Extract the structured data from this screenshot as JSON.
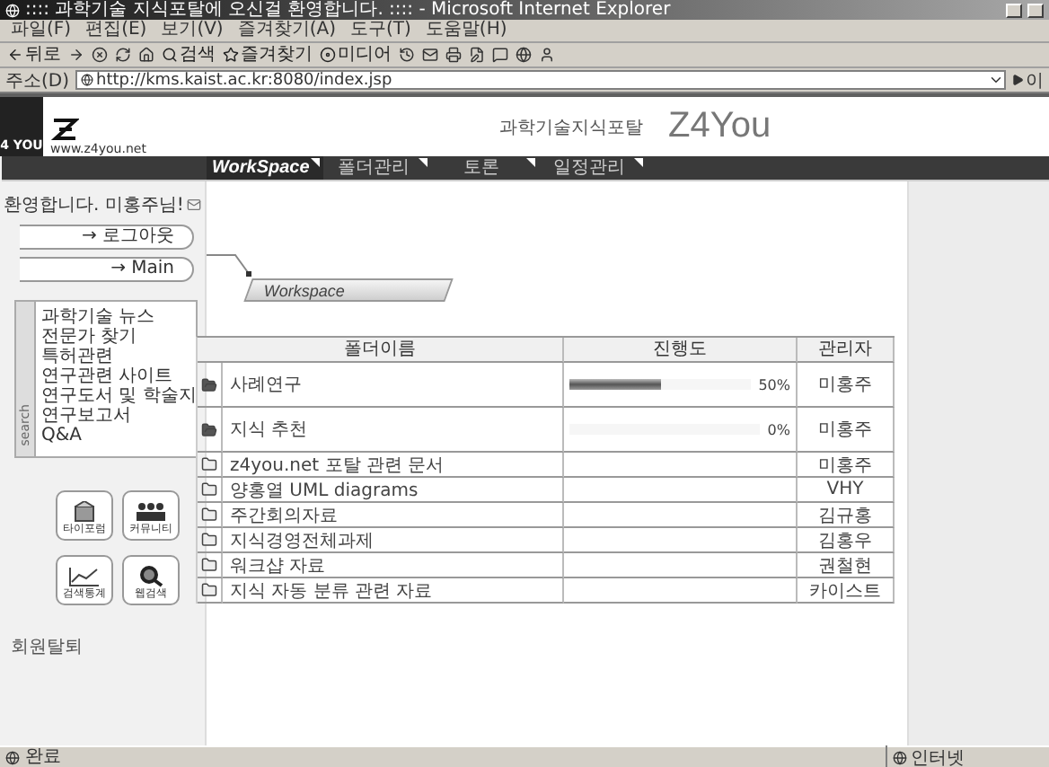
{
  "window": {
    "title": ":::: 과학기술 지식포탈에 오신걸 환영합니다. :::: - Microsoft Internet Explorer"
  },
  "menu": [
    "파일(F)",
    "편집(E)",
    "보기(V)",
    "즐겨찾기(A)",
    "도구(T)",
    "도움말(H)"
  ],
  "toolbar": [
    {
      "kind": "back",
      "label": "뒤로"
    },
    {
      "kind": "forward"
    },
    {
      "kind": "stop"
    },
    {
      "kind": "refresh"
    },
    {
      "kind": "home"
    },
    {
      "kind": "search",
      "label": "검색"
    },
    {
      "kind": "favorites",
      "label": "즐겨찾기"
    },
    {
      "kind": "media",
      "label": "미디어"
    },
    {
      "kind": "history"
    },
    {
      "kind": "mail"
    },
    {
      "kind": "print"
    },
    {
      "kind": "edit"
    },
    {
      "kind": "discuss"
    },
    {
      "kind": "messenger"
    },
    {
      "kind": "user"
    }
  ],
  "address": {
    "label": "주소(D)",
    "value": "http://kms.kaist.ac.kr:8080/index.jsp",
    "go": "이"
  },
  "header": {
    "badge": "4 YOU",
    "site": "www.z4you.net",
    "tagline": "과학기술지식포탈",
    "brand": "Z4You"
  },
  "nav": [
    {
      "label": "WorkSpace",
      "selected": true
    },
    {
      "label": "폴더관리",
      "selected": false
    },
    {
      "label": "토론",
      "selected": false
    },
    {
      "label": "일정관리",
      "selected": false
    }
  ],
  "sidebar": {
    "greeting": "환영합니다. 미홍주님!",
    "buttons": [
      "→ 로그아웃",
      "→ Main"
    ],
    "search_tab": "search",
    "links": [
      "과학기술 뉴스",
      "전문가 찾기",
      "특허관련",
      "연구관련 사이트",
      "연구도서 및 학술지",
      "연구보고서",
      "Q&A"
    ],
    "shortcuts": [
      {
        "kind": "forum",
        "label": "타이포럼"
      },
      {
        "kind": "community",
        "label": "커뮤니티"
      },
      {
        "kind": "stats",
        "label": "검색통계"
      },
      {
        "kind": "websearch",
        "label": "웹검색"
      }
    ],
    "withdraw": "회원탈퇴"
  },
  "workspace": {
    "title": "Workspace",
    "columns": [
      "폴더이름",
      "진행도",
      "관리자"
    ],
    "rows": [
      {
        "kind": "project",
        "name": "사례연구",
        "progress": "50%",
        "level": 0.5,
        "manager": "미홍주"
      },
      {
        "kind": "project",
        "name": "지식 추천",
        "progress": "0%",
        "level": 0,
        "manager": "미홍주"
      },
      {
        "kind": "folder",
        "name": "z4you.net 포탈 관련 문서",
        "manager": "미홍주"
      },
      {
        "kind": "folder",
        "name": "양홍열 UML diagrams",
        "manager": "VHY"
      },
      {
        "kind": "folder",
        "name": "주간회의자료",
        "manager": "김규홍"
      },
      {
        "kind": "folder",
        "name": "지식경영전체과제",
        "manager": "김홍우"
      },
      {
        "kind": "folder",
        "name": "워크샵 자료",
        "manager": "권철현"
      },
      {
        "kind": "folder",
        "name": "지식 자동 분류 관련 자료",
        "manager": "카이스트"
      }
    ]
  },
  "status_bar": {
    "text": "완료",
    "zone": "인터넷"
  }
}
